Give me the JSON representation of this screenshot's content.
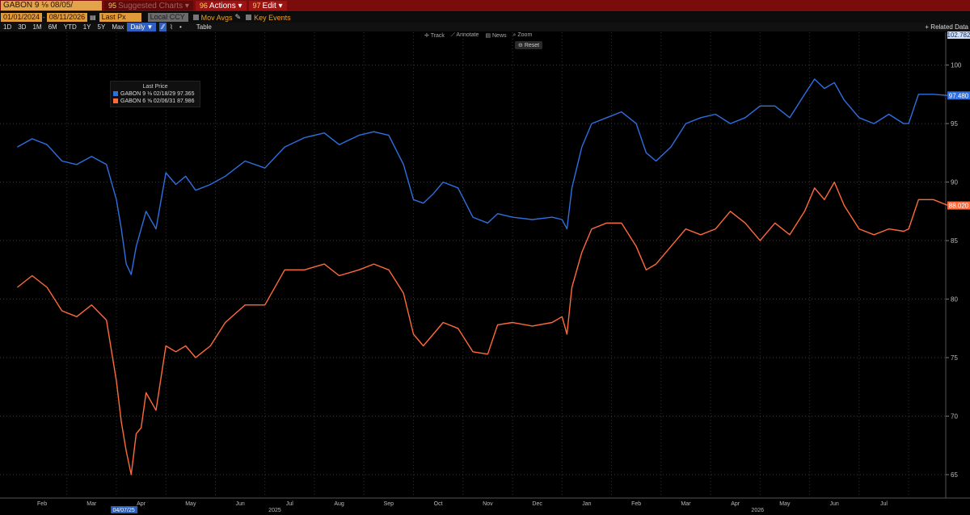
{
  "toolbar": {
    "ticker": "GABON 9 ⅛ 08/05/",
    "suggested_label": "Suggested Charts",
    "suggested_num": "95",
    "actions_label": "Actions",
    "actions_num": "96",
    "edit_label": "Edit",
    "edit_num": "97"
  },
  "controls": {
    "start_date": "01/01/2024",
    "end_date": "08/11/2026",
    "field": "Last Px",
    "currency": "Local CCY",
    "mov_avgs": "Mov Avgs",
    "key_events": "Key Events"
  },
  "periods": [
    "1D",
    "3D",
    "1M",
    "6M",
    "YTD",
    "1Y",
    "5Y",
    "Max"
  ],
  "frequency": "Daily ▼",
  "table_label": "Table",
  "related_label": "+ Related Data",
  "tools": [
    "Track",
    "Annotate",
    "News",
    "Zoom"
  ],
  "reset_label": "Reset",
  "legend": {
    "title": "Last Price",
    "items": [
      {
        "label": "GABON 9 ⅛ 02/18/29",
        "value": "97.365",
        "color": "#2f6fe0"
      },
      {
        "label": "GABON 6 ⅝ 02/06/31",
        "value": "87.986",
        "color": "#ff6a3c"
      }
    ]
  },
  "last_value_badges": [
    "97.480",
    "88.020"
  ],
  "top_badge": "102.782",
  "x_marker_label": "04/07/25",
  "chart_data": {
    "type": "line",
    "ylim": [
      63,
      102.8
    ],
    "yticks": [
      65,
      70,
      75,
      80,
      85,
      90,
      95,
      100
    ],
    "x_months": [
      {
        "label": "Feb",
        "t": 0.5
      },
      {
        "label": "Mar",
        "t": 1.5
      },
      {
        "label": "Apr",
        "t": 2.5
      },
      {
        "label": "May",
        "t": 3.5
      },
      {
        "label": "Jun",
        "t": 4.5
      },
      {
        "label": "Jul",
        "t": 5.5
      },
      {
        "label": "Aug",
        "t": 6.5
      },
      {
        "label": "Sep",
        "t": 7.5
      },
      {
        "label": "Oct",
        "t": 8.5
      },
      {
        "label": "Nov",
        "t": 9.5
      },
      {
        "label": "Dec",
        "t": 10.5
      },
      {
        "label": "Jan",
        "t": 11.5
      },
      {
        "label": "Feb",
        "t": 12.5
      },
      {
        "label": "Mar",
        "t": 13.5
      },
      {
        "label": "Apr",
        "t": 14.5
      },
      {
        "label": "May",
        "t": 15.5
      },
      {
        "label": "Jun",
        "t": 16.5
      },
      {
        "label": "Jul",
        "t": 17.5
      }
    ],
    "year_labels": [
      {
        "label": "2025",
        "t": 5.2
      },
      {
        "label": "2026",
        "t": 14.95
      }
    ],
    "series": [
      {
        "name": "GABON 9 ⅛ 02/18/29",
        "color": "#2f6fe0",
        "x": [
          0,
          0.3,
          0.6,
          0.9,
          1.2,
          1.5,
          1.8,
          2.0,
          2.1,
          2.2,
          2.3,
          2.4,
          2.5,
          2.6,
          2.8,
          3.0,
          3.2,
          3.4,
          3.6,
          3.9,
          4.2,
          4.6,
          5.0,
          5.4,
          5.8,
          6.2,
          6.5,
          6.9,
          7.2,
          7.5,
          7.8,
          8.0,
          8.2,
          8.4,
          8.6,
          8.9,
          9.2,
          9.5,
          9.7,
          10.0,
          10.4,
          10.8,
          11.0,
          11.1,
          11.2,
          11.4,
          11.6,
          11.9,
          12.2,
          12.5,
          12.7,
          12.9,
          13.2,
          13.5,
          13.8,
          14.1,
          14.4,
          14.7,
          15.0,
          15.3,
          15.6,
          15.9,
          16.1,
          16.3,
          16.5,
          16.7,
          17.0,
          17.3,
          17.6,
          17.9,
          18.0,
          18.2,
          18.5,
          18.8
        ],
        "y": [
          93.0,
          93.7,
          93.2,
          91.8,
          91.5,
          92.2,
          91.5,
          88.5,
          86.0,
          83.0,
          82.1,
          84.5,
          86.0,
          87.5,
          86.0,
          90.8,
          89.8,
          90.5,
          89.3,
          89.8,
          90.5,
          91.8,
          91.2,
          93.0,
          93.8,
          94.2,
          93.2,
          94.0,
          94.3,
          94.0,
          91.5,
          88.5,
          88.2,
          89.0,
          90.0,
          89.5,
          87.0,
          86.5,
          87.3,
          87.0,
          86.8,
          87.0,
          86.8,
          86.0,
          89.5,
          93.0,
          95.0,
          95.5,
          96.0,
          95.0,
          92.5,
          91.8,
          93.0,
          95.0,
          95.5,
          95.8,
          95.0,
          95.5,
          96.5,
          96.5,
          95.5,
          97.5,
          98.8,
          98.0,
          98.5,
          97.0,
          95.5,
          95.0,
          95.8,
          95.0,
          95.0,
          97.5,
          97.5,
          97.4
        ]
      },
      {
        "name": "GABON 6 ⅝ 02/06/31",
        "color": "#ff6a3c",
        "x": [
          0,
          0.3,
          0.6,
          0.9,
          1.2,
          1.5,
          1.8,
          2.0,
          2.1,
          2.2,
          2.3,
          2.4,
          2.5,
          2.6,
          2.8,
          3.0,
          3.2,
          3.4,
          3.6,
          3.9,
          4.2,
          4.6,
          5.0,
          5.4,
          5.8,
          6.2,
          6.5,
          6.9,
          7.2,
          7.5,
          7.8,
          8.0,
          8.2,
          8.4,
          8.6,
          8.9,
          9.2,
          9.5,
          9.7,
          10.0,
          10.4,
          10.8,
          11.0,
          11.1,
          11.2,
          11.4,
          11.6,
          11.9,
          12.2,
          12.5,
          12.7,
          12.9,
          13.2,
          13.5,
          13.8,
          14.1,
          14.4,
          14.7,
          15.0,
          15.3,
          15.6,
          15.9,
          16.1,
          16.3,
          16.5,
          16.7,
          17.0,
          17.3,
          17.6,
          17.9,
          18.0,
          18.2,
          18.5,
          18.8
        ],
        "y": [
          81.0,
          82.0,
          81.0,
          79.0,
          78.5,
          79.5,
          78.2,
          73.0,
          69.5,
          67.0,
          65.0,
          68.5,
          69.0,
          72.0,
          70.5,
          76.0,
          75.5,
          76.0,
          75.0,
          76.0,
          78.0,
          79.5,
          79.5,
          82.5,
          82.5,
          83.0,
          82.0,
          82.5,
          83.0,
          82.5,
          80.5,
          77.0,
          76.0,
          77.0,
          78.0,
          77.5,
          75.5,
          75.3,
          77.8,
          78.0,
          77.7,
          78.0,
          78.5,
          77.0,
          81.0,
          84.0,
          86.0,
          86.5,
          86.5,
          84.5,
          82.5,
          83.0,
          84.5,
          86.0,
          85.5,
          86.0,
          87.5,
          86.5,
          85.0,
          86.5,
          85.5,
          87.5,
          89.5,
          88.5,
          90.0,
          88.0,
          86.0,
          85.5,
          86.0,
          85.8,
          86.0,
          88.5,
          88.5,
          88.0
        ]
      }
    ]
  }
}
